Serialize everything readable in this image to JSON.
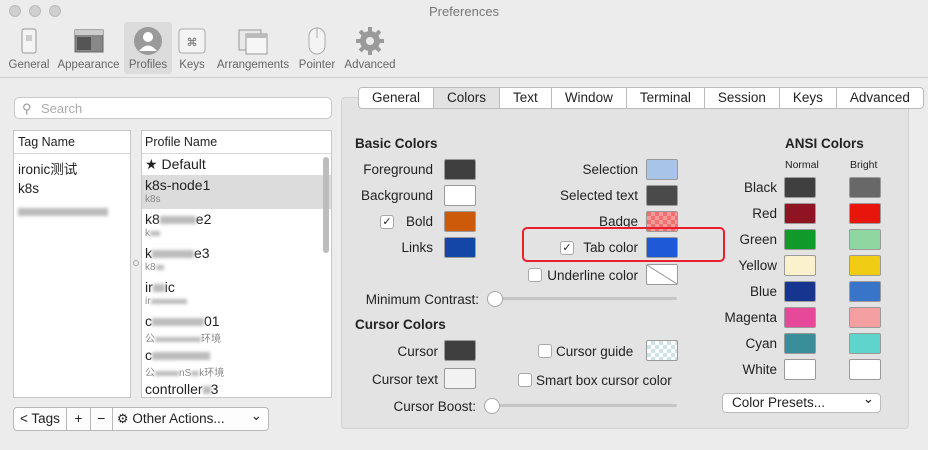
{
  "window": {
    "title": "Preferences"
  },
  "toolbar": {
    "items": [
      {
        "label": "General",
        "icon": "general-switch-icon"
      },
      {
        "label": "Appearance",
        "icon": "appearance-window-icon"
      },
      {
        "label": "Profiles",
        "icon": "profile-person-icon",
        "active": true
      },
      {
        "label": "Keys",
        "icon": "command-key-icon"
      },
      {
        "label": "Arrangements",
        "icon": "arrangements-windows-icon"
      },
      {
        "label": "Pointer",
        "icon": "mouse-pointer-icon"
      },
      {
        "label": "Advanced",
        "icon": "gear-icon"
      }
    ]
  },
  "search": {
    "placeholder": "Search"
  },
  "tags": {
    "header": "Tag Name",
    "items": [
      "ironic测试",
      "k8s"
    ]
  },
  "profiles": {
    "header": "Profile Name",
    "default_star": "★",
    "items": [
      {
        "name": "Default",
        "sub": ""
      },
      {
        "name": "k8s-node1",
        "sub": "k8s"
      },
      {
        "name": "k8",
        "name_tail": "e2",
        "sub": "k"
      },
      {
        "name": "k",
        "name_tail": "e3",
        "sub": "k8"
      },
      {
        "name": "ir",
        "name_tail": "ic",
        "sub": "ir"
      },
      {
        "name": "c",
        "name_tail": "01",
        "sub": "公",
        "sub_tail": "环境"
      },
      {
        "name": "c",
        "name_tail": "",
        "sub": "公",
        "sub_mid": "nS",
        "sub_tail": "k环境"
      },
      {
        "name": "controller",
        "name_tail": "3",
        "sub": ""
      }
    ]
  },
  "bottom": {
    "tags_button": "< Tags",
    "add": "+",
    "remove": "−",
    "other_actions": "Other Actions...",
    "gear": "⚙",
    "chevron": "⌄"
  },
  "tabs": [
    "General",
    "Colors",
    "Text",
    "Window",
    "Terminal",
    "Session",
    "Keys",
    "Advanced"
  ],
  "active_tab": "Colors",
  "basic_colors": {
    "title": "Basic Colors",
    "foreground": {
      "label": "Foreground",
      "color": "#3f3f3f"
    },
    "background": {
      "label": "Background",
      "color": "#ffffff"
    },
    "bold": {
      "label": "Bold",
      "color": "#cc5a08",
      "checked": true
    },
    "links": {
      "label": "Links",
      "color": "#1446a8"
    },
    "selection": {
      "label": "Selection",
      "color": "#a8c4e8"
    },
    "selected_text": {
      "label": "Selected text",
      "color": "#4a4a4a"
    },
    "badge": {
      "label": "Badge",
      "color": "#f07070"
    },
    "tab_color": {
      "label": "Tab color",
      "color": "#1e5ad8",
      "checked": true
    },
    "underline_color": {
      "label": "Underline color",
      "checked": false
    }
  },
  "min_contrast": {
    "label": "Minimum Contrast:",
    "value": 0
  },
  "cursor_colors": {
    "title": "Cursor Colors",
    "cursor": {
      "label": "Cursor",
      "color": "#3f3f3f"
    },
    "cursor_text": {
      "label": "Cursor text",
      "color": "#f2f2f2"
    },
    "cursor_guide": {
      "label": "Cursor guide",
      "checked": false
    },
    "smart_box": {
      "label": "Smart box cursor color",
      "checked": false
    },
    "cursor_boost": {
      "label": "Cursor Boost:",
      "value": 0
    }
  },
  "ansi": {
    "title": "ANSI Colors",
    "normal_label": "Normal",
    "bright_label": "Bright",
    "rows": [
      {
        "name": "Black",
        "normal": "#3f3f3f",
        "bright": "#686868"
      },
      {
        "name": "Red",
        "normal": "#8f1321",
        "bright": "#e8150d"
      },
      {
        "name": "Green",
        "normal": "#0f9a2a",
        "bright": "#8fd6a0"
      },
      {
        "name": "Yellow",
        "normal": "#fbf1cc",
        "bright": "#f0cc14"
      },
      {
        "name": "Blue",
        "normal": "#16358f",
        "bright": "#3874c8"
      },
      {
        "name": "Magenta",
        "normal": "#e8489a",
        "bright": "#f4a0a0"
      },
      {
        "name": "Cyan",
        "normal": "#3a8e9a",
        "bright": "#5fd4cc"
      },
      {
        "name": "White",
        "normal": "#ffffff",
        "bright": "#ffffff"
      }
    ]
  },
  "color_presets": {
    "label": "Color Presets...",
    "chevron": "⌄"
  },
  "checkmark": "✓"
}
